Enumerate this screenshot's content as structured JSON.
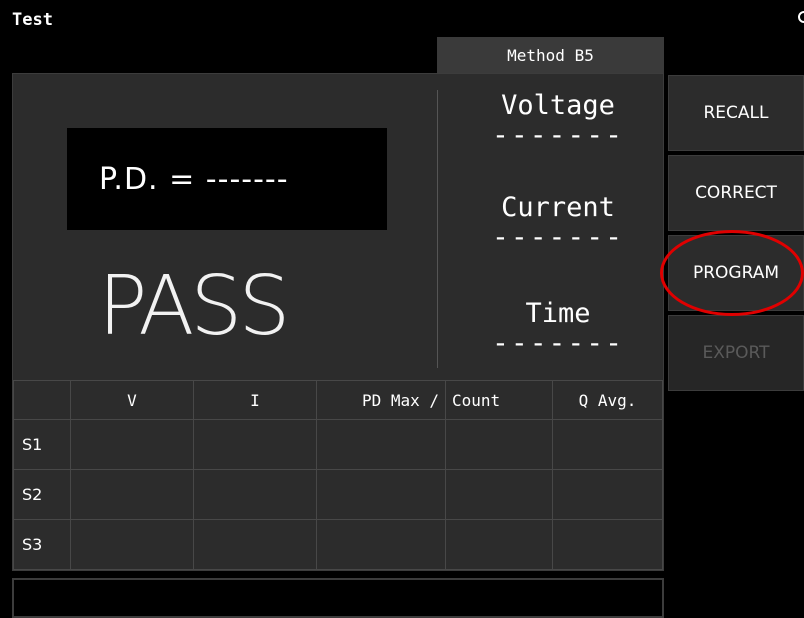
{
  "window": {
    "title": "Test"
  },
  "method_tab": {
    "label": "Method B5"
  },
  "pd_display": {
    "text": "P.D. = -------"
  },
  "result": {
    "status": "PASS"
  },
  "measurements": {
    "voltage": {
      "label": "Voltage",
      "value": "-------"
    },
    "current": {
      "label": "Current",
      "value": "-------"
    },
    "time": {
      "label": "Time",
      "value": "-------"
    }
  },
  "table": {
    "headers": [
      "",
      "V",
      "I",
      "PD Max /",
      "Count",
      "Q Avg."
    ],
    "rows": [
      {
        "label": "S1",
        "cells": [
          "",
          "",
          "",
          "",
          ""
        ]
      },
      {
        "label": "S2",
        "cells": [
          "",
          "",
          "",
          "",
          ""
        ]
      },
      {
        "label": "S3",
        "cells": [
          "",
          "",
          "",
          "",
          ""
        ]
      }
    ]
  },
  "side_buttons": {
    "recall": "RECALL",
    "correct": "CORRECT",
    "program": "PROGRAM",
    "export": "EXPORT"
  },
  "colors": {
    "highlight": "#e00000",
    "panel": "#2c2c2c"
  },
  "icons": {
    "corner": "globe-icon"
  }
}
